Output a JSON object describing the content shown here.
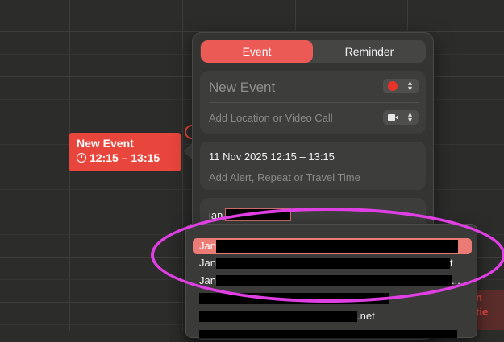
{
  "calendar_event": {
    "title": "New Event",
    "time": "12:15 – 13:15"
  },
  "popover": {
    "tabs": {
      "event": "Event",
      "reminder": "Reminder"
    },
    "title_placeholder": "New Event",
    "location_placeholder": "Add Location or Video Call",
    "date_time": "11 Nov 2025  12:15 – 13:15",
    "alert_placeholder": "Add Alert, Repeat or Travel Time",
    "invitee_input": "jan"
  },
  "suggestions": [
    {
      "prefix": "Jan ",
      "suffix": ""
    },
    {
      "prefix": "Jan ",
      "suffix": "t"
    },
    {
      "prefix": "Jan ",
      "suffix": "..."
    },
    {
      "prefix": "",
      "suffix": ""
    },
    {
      "prefix": "",
      "suffix": ".net"
    },
    {
      "prefix": "",
      "suffix": ""
    }
  ],
  "background_event": {
    "line1": "n",
    "line2": "tie"
  },
  "colors": {
    "accent": "#e8453c",
    "selected_row": "#ec7b76",
    "annotation": "#df3fe3"
  },
  "icons": [
    "clock-icon",
    "chevron-updown-icon",
    "video-camera-icon",
    "color-dot-icon"
  ]
}
